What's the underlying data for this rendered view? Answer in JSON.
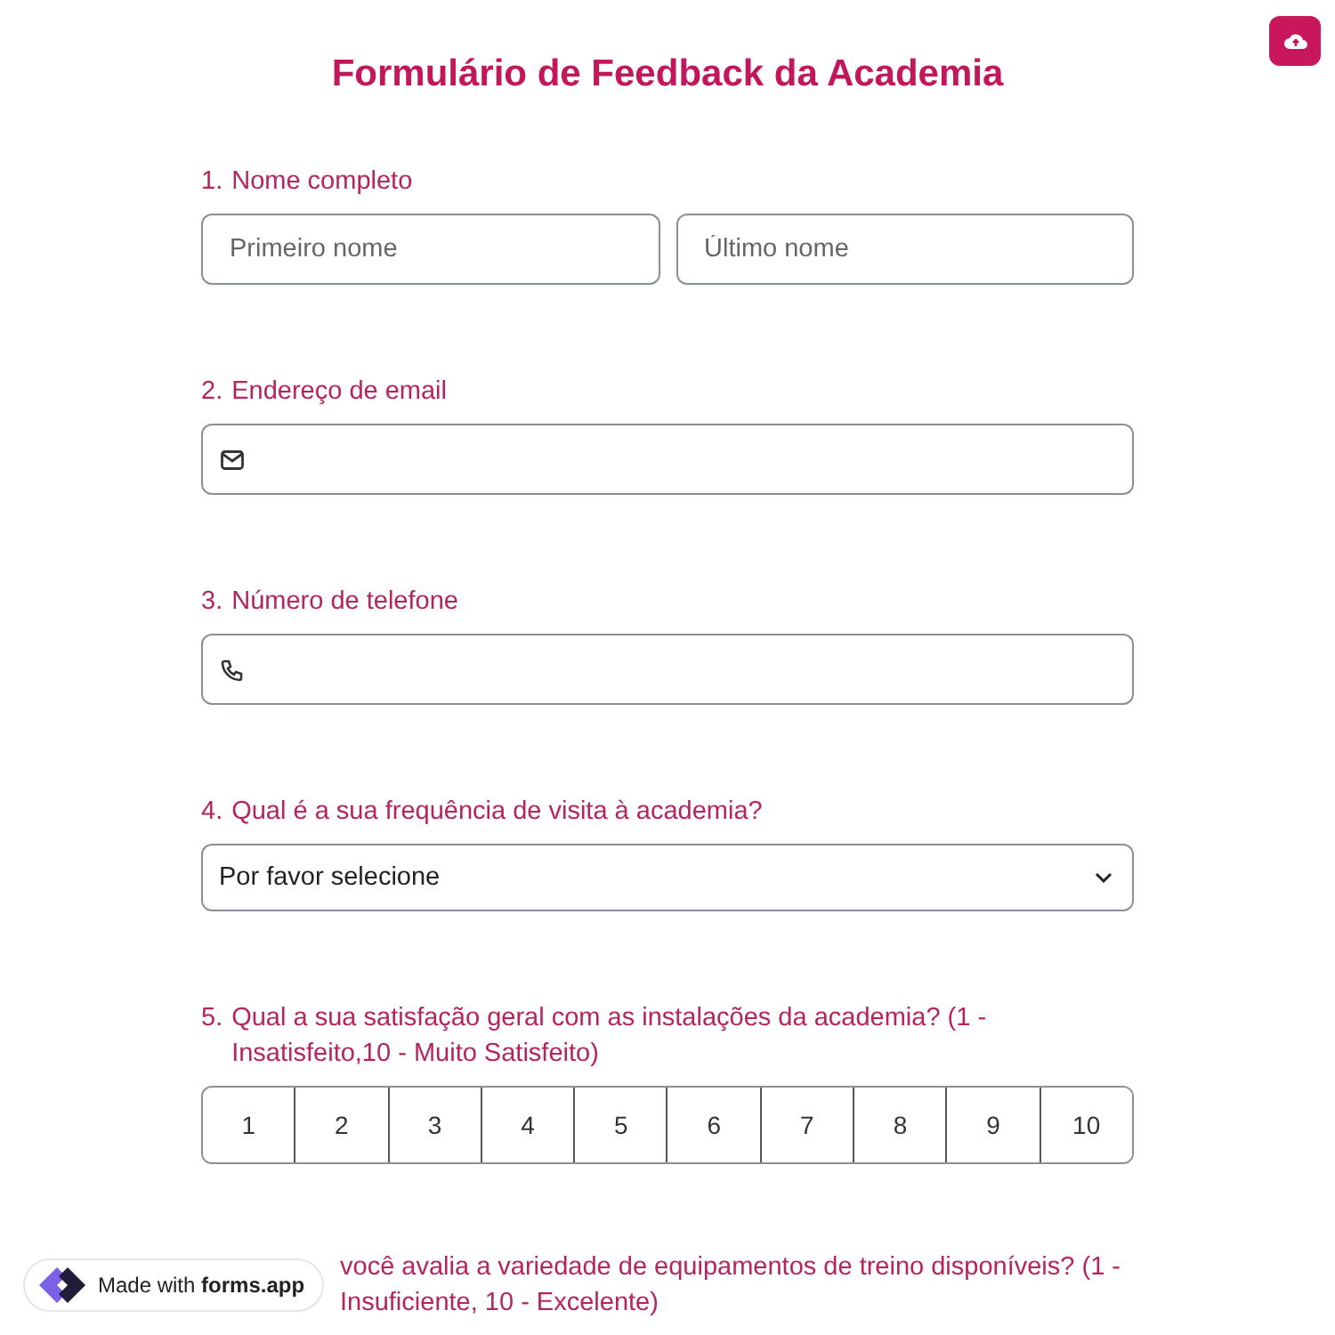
{
  "title": "Formulário de Feedback da Academia",
  "questions": [
    {
      "kind": "name",
      "number": "1.",
      "label": "Nome completo",
      "fields": [
        {
          "placeholder": "Primeiro nome"
        },
        {
          "placeholder": "Último nome"
        }
      ]
    },
    {
      "kind": "email",
      "number": "2.",
      "label": "Endereço de email"
    },
    {
      "kind": "phone",
      "number": "3.",
      "label": "Número de telefone"
    },
    {
      "kind": "select",
      "number": "4.",
      "label": "Qual é a sua frequência de visita à academia?",
      "value": "Por favor selecione"
    },
    {
      "kind": "scale",
      "number": "5.",
      "label": "Qual a sua satisfação geral com as instalações da academia? (1 - Insatisfeito,10 - Muito Satisfeito)",
      "options": [
        "1",
        "2",
        "3",
        "4",
        "5",
        "6",
        "7",
        "8",
        "9",
        "10"
      ]
    },
    {
      "kind": "partial",
      "label": "você avalia a variedade de equipamentos de treino disponíveis? (1 - Insuficiente, 10 - Excelente)"
    }
  ],
  "badge": {
    "prefix": "Made with",
    "brand": "forms.app"
  }
}
